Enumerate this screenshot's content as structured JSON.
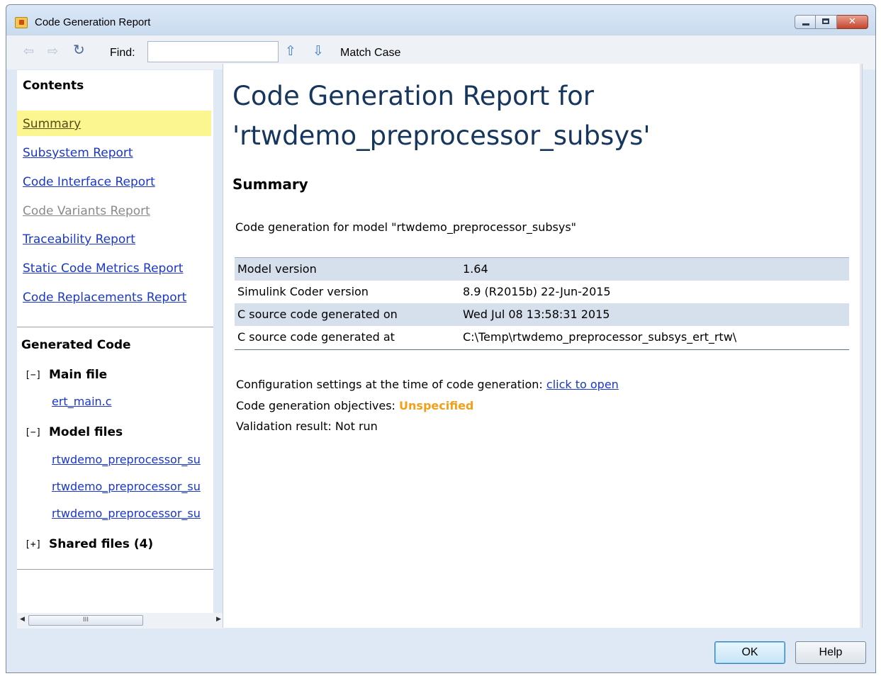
{
  "window": {
    "title": "Code Generation Report"
  },
  "window_controls": {
    "close_glyph": "✕"
  },
  "toolbar": {
    "back_icon": "⇦",
    "forward_icon": "⇨",
    "refresh_icon": "↻",
    "find_label": "Find:",
    "find_value": "",
    "find_placeholder": "",
    "up_icon": "⇧",
    "down_icon": "⇩",
    "match_case_label": "Match Case"
  },
  "sidebar": {
    "contents_heading": "Contents",
    "links": [
      {
        "label": "Summary",
        "state": "active"
      },
      {
        "label": "Subsystem Report",
        "state": "link"
      },
      {
        "label": "Code Interface Report",
        "state": "link"
      },
      {
        "label": "Code Variants Report",
        "state": "disabled"
      },
      {
        "label": "Traceability Report",
        "state": "link"
      },
      {
        "label": "Static Code Metrics Report",
        "state": "link"
      },
      {
        "label": "Code Replacements Report",
        "state": "link"
      }
    ],
    "generated_code_heading": "Generated Code",
    "main_file": {
      "toggle": "[−]",
      "label": "Main file",
      "files": [
        "ert_main.c"
      ]
    },
    "model_files": {
      "toggle": "[−]",
      "label": "Model files",
      "files": [
        "rtwdemo_preprocessor_su",
        "rtwdemo_preprocessor_su",
        "rtwdemo_preprocessor_su"
      ]
    },
    "shared_files": {
      "toggle": "[+]",
      "label": "Shared files (4)"
    },
    "scrollbar": {
      "left_arrow": "◀",
      "right_arrow": "▶",
      "thumb_grip": "III"
    }
  },
  "report": {
    "title_line1": "Code Generation Report for",
    "title_line2": "'rtwdemo_preprocessor_subsys'",
    "summary_heading": "Summary",
    "model_line": "Code generation for model \"rtwdemo_preprocessor_subsys\"",
    "table": [
      {
        "key": "Model version",
        "value": "1.64"
      },
      {
        "key": "Simulink Coder version",
        "value": "8.9 (R2015b) 22-Jun-2015"
      },
      {
        "key": "C source code generated on",
        "value": "Wed Jul 08 13:58:31 2015"
      },
      {
        "key": "C source code generated at",
        "value": "C:\\Temp\\rtwdemo_preprocessor_subsys_ert_rtw\\"
      }
    ],
    "config_prefix": "Configuration settings at the time of code generation: ",
    "config_link": "click to open",
    "objectives_prefix": "Code generation objectives: ",
    "objectives_value": "Unspecified",
    "validation_line": "Validation result: Not run",
    "unspecified_color": "#f2a01a"
  },
  "buttons": {
    "ok_label": "OK",
    "help_label": "Help"
  }
}
